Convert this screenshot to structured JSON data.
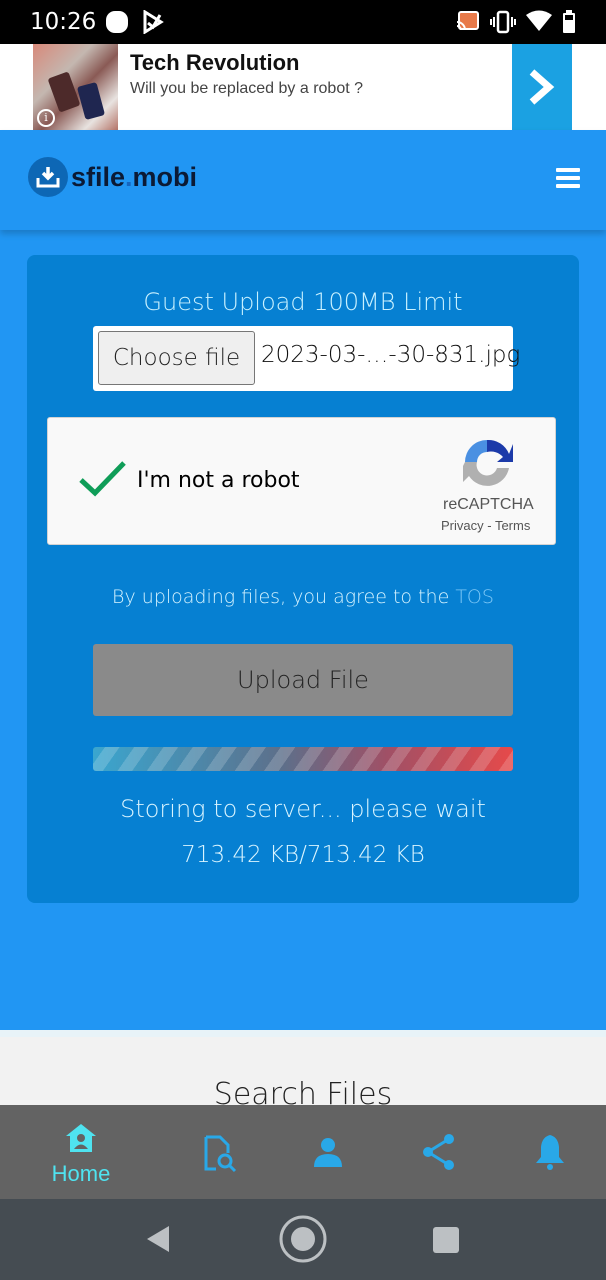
{
  "status_bar": {
    "time": "10:26",
    "icons": [
      "notification-dot-icon",
      "play-store-icon",
      "cast-icon",
      "vibrate-icon",
      "wifi-icon",
      "battery-icon"
    ]
  },
  "ad": {
    "title": "Tech Revolution",
    "subtitle": "Will you be replaced by a robot ?",
    "info_icon": "i",
    "accent": "#1ba1e2"
  },
  "header": {
    "logo_part1": "sfile",
    "logo_dot": ".",
    "logo_part2": "mobi",
    "background": "#2196f3"
  },
  "upload": {
    "limit_text": "Guest Upload 100MB Limit",
    "choose_label": "Choose file",
    "file_name": "2023-03-…-30-831.jpg",
    "captcha": {
      "label": "I'm not a robot",
      "checked": true,
      "brand": "reCAPTCHA",
      "privacy": "Privacy",
      "separator": " - ",
      "terms": "Terms"
    },
    "tos_text": "By uploading files, you agree to the ",
    "tos_link": "TOS",
    "upload_button": "Upload File",
    "progress_percent": 100,
    "status_text": "Storing to server... please wait",
    "size_text": "713.42 KB/713.42 KB"
  },
  "lower": {
    "search_title": "Search Files"
  },
  "bottom_nav": {
    "items": [
      {
        "label": "Home",
        "icon": "home-icon",
        "active": true
      },
      {
        "label": "",
        "icon": "file-search-icon",
        "active": false
      },
      {
        "label": "",
        "icon": "user-icon",
        "active": false
      },
      {
        "label": "",
        "icon": "share-icon",
        "active": false
      },
      {
        "label": "",
        "icon": "bell-icon",
        "active": false
      }
    ],
    "active_color": "#4fe3f0",
    "icon_color": "#29a8e8"
  }
}
